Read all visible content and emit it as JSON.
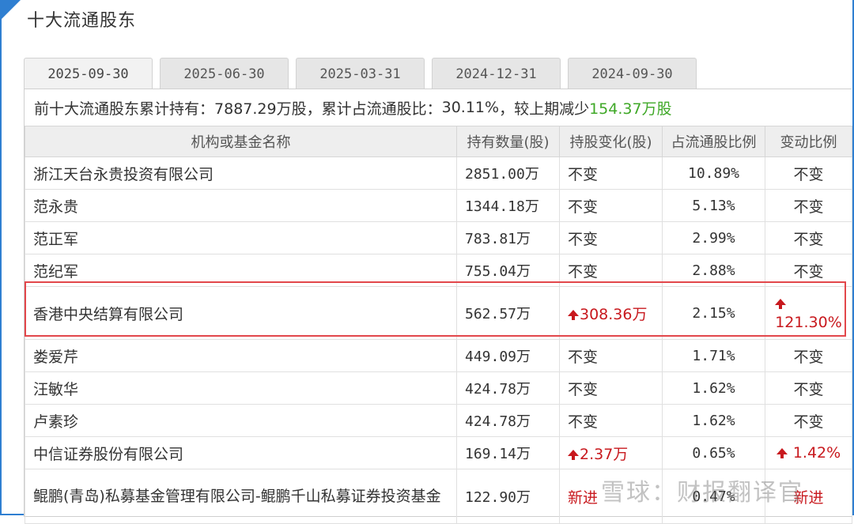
{
  "title": "十大流通股东",
  "tabs": [
    {
      "label": "2025-09-30",
      "active": true
    },
    {
      "label": "2025-06-30",
      "active": false
    },
    {
      "label": "2025-03-31",
      "active": false
    },
    {
      "label": "2024-12-31",
      "active": false
    },
    {
      "label": "2024-09-30",
      "active": false
    }
  ],
  "summary": {
    "lead": "前十大流通股东累计持有：",
    "holding": "7887.29万股",
    "ratio_label": "，累计占流通股比：",
    "ratio": "30.11%",
    "change_label": "，较上期减少",
    "change": "154.37万股"
  },
  "table": {
    "headers": [
      "机构或基金名称",
      "持有数量(股)",
      "持股变化(股)",
      "占流通股比例",
      "变动比例"
    ],
    "rows": [
      {
        "name": "浙江天台永贵投资有限公司",
        "quantity": "2851.00万",
        "change": "不变",
        "pct": "10.89%",
        "ratio": "不变"
      },
      {
        "name": "范永贵",
        "quantity": "1344.18万",
        "change": "不变",
        "pct": "5.13%",
        "ratio": "不变"
      },
      {
        "name": "范正军",
        "quantity": "783.81万",
        "change": "不变",
        "pct": "2.99%",
        "ratio": "不变"
      },
      {
        "name": "范纪军",
        "quantity": "755.04万",
        "change": "不变",
        "pct": "2.88%",
        "ratio": "不变"
      },
      {
        "name": "香港中央结算有限公司",
        "quantity": "562.57万",
        "change": "308.36万",
        "pct": "2.15%",
        "ratio": "121.30%"
      },
      {
        "name": "娄爱芹",
        "quantity": "449.09万",
        "change": "不变",
        "pct": "1.71%",
        "ratio": "不变"
      },
      {
        "name": "汪敏华",
        "quantity": "424.78万",
        "change": "不变",
        "pct": "1.62%",
        "ratio": "不变"
      },
      {
        "name": "卢素珍",
        "quantity": "424.78万",
        "change": "不变",
        "pct": "1.62%",
        "ratio": "不变"
      },
      {
        "name": "中信证券股份有限公司",
        "quantity": "169.14万",
        "change": "2.37万",
        "pct": "0.65%",
        "ratio": "1.42%"
      },
      {
        "name": "鲲鹏(青岛)私募基金管理有限公司-鲲鹏千山私募证券投资基金",
        "quantity": "122.90万",
        "change": "新进",
        "pct": "0.47%",
        "ratio": "新进"
      }
    ]
  },
  "watermark": "雪球：财报翻译官",
  "colors": {
    "frame": "#2f7fd1",
    "increase": "#c8191e",
    "decrease": "#3fa827",
    "highlight": "#e2474b"
  }
}
